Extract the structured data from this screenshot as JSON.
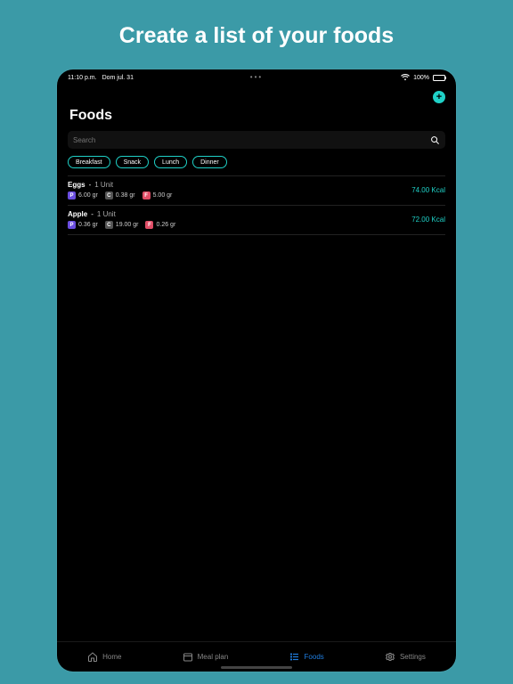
{
  "promo": {
    "title": "Create a list of your foods"
  },
  "status": {
    "time": "11:10 p.m.",
    "date": "Dom jul. 31",
    "battery": "100%"
  },
  "header": {
    "page_title": "Foods",
    "add_label": "+"
  },
  "search": {
    "placeholder": "Search"
  },
  "chips": [
    "Breakfast",
    "Snack",
    "Lunch",
    "Dinner"
  ],
  "macro_labels": {
    "p": "P",
    "c": "C",
    "f": "F"
  },
  "foods": [
    {
      "name": "Eggs",
      "sep": "-",
      "unit": "1 Unit",
      "p": "6.00 gr",
      "c": "0.38 gr",
      "f": "5.00 gr",
      "kcal": "74.00 Kcal"
    },
    {
      "name": "Apple",
      "sep": "-",
      "unit": "1 Unit",
      "p": "0.36 gr",
      "c": "19.00 gr",
      "f": "0.26 gr",
      "kcal": "72.00 Kcal"
    }
  ],
  "tabs": {
    "home": "Home",
    "meal": "Meal plan",
    "foods": "Foods",
    "settings": "Settings"
  }
}
